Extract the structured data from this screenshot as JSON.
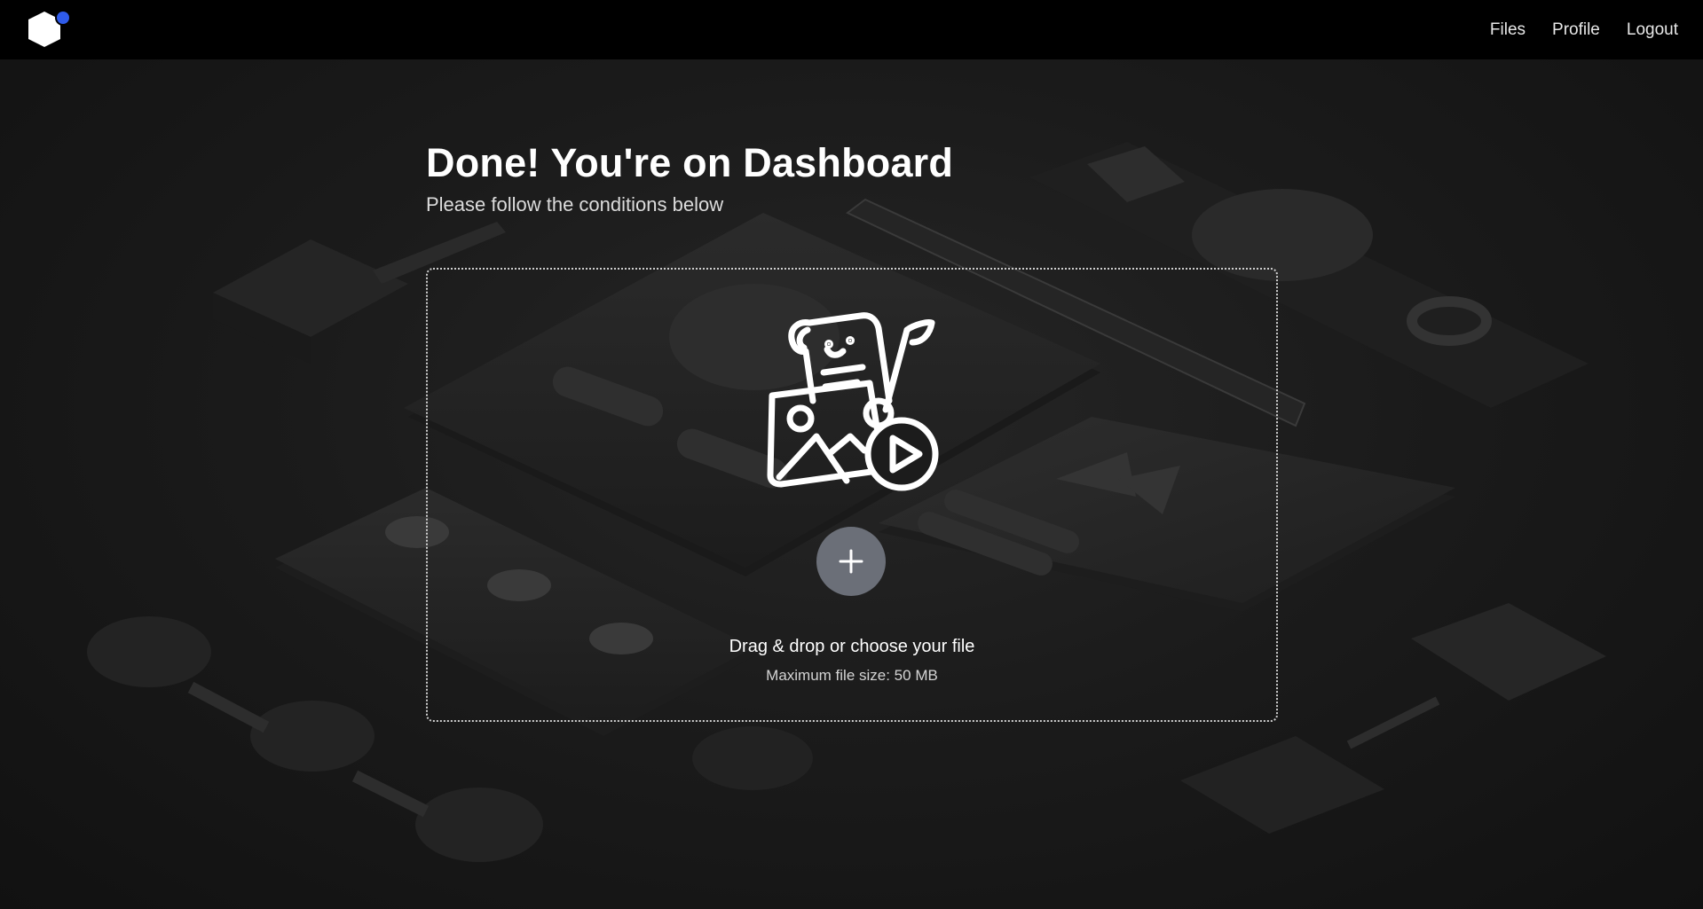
{
  "nav": {
    "links": [
      "Files",
      "Profile",
      "Logout"
    ]
  },
  "main": {
    "title": "Done! You're on Dashboard",
    "subtitle": "Please follow the conditions below"
  },
  "dropzone": {
    "title": "Drag & drop or choose your file",
    "hint": "Maximum file size: 50 MB",
    "add_icon": "plus-icon",
    "illustration_icon": "media-files-icon"
  },
  "colors": {
    "topbar": "#000000",
    "accent": "#2f5bea",
    "add_button": "#6b6f78",
    "background": "#1b1b1b"
  }
}
